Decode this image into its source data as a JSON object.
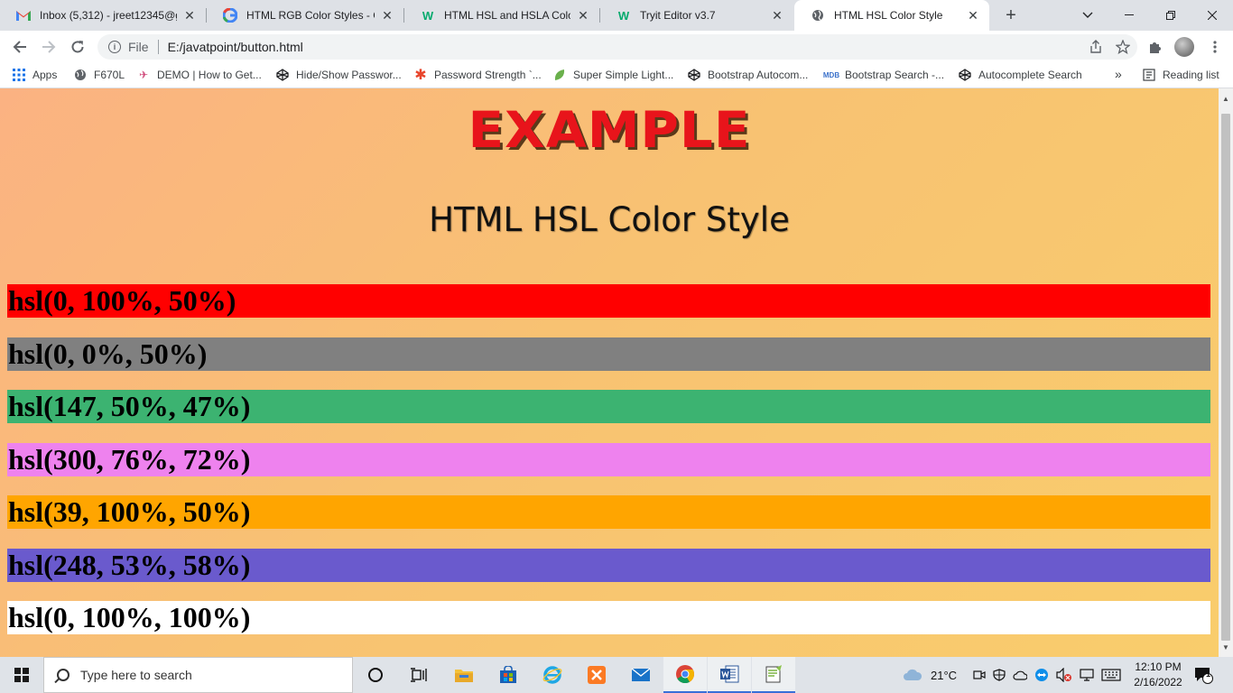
{
  "browser": {
    "tabs": [
      {
        "title": "Inbox (5,312) - jreet12345@g",
        "icon": "gmail-icon",
        "active": false
      },
      {
        "title": "HTML RGB Color Styles - Goo",
        "icon": "google-icon",
        "active": false
      },
      {
        "title": "HTML HSL and HSLA Colors",
        "icon": "w3schools-icon",
        "active": false
      },
      {
        "title": "Tryit Editor v3.7",
        "icon": "w3schools-icon",
        "active": false
      },
      {
        "title": "HTML HSL Color Style",
        "icon": "globe-icon",
        "active": true
      }
    ],
    "address": {
      "scheme": "File",
      "url": "E:/javatpoint/button.html"
    },
    "bookmarks": [
      {
        "label": "Apps",
        "icon": "apps-grid-icon"
      },
      {
        "label": "F670L",
        "icon": "globe-icon"
      },
      {
        "label": "DEMO | How to Get...",
        "icon": "bird-icon"
      },
      {
        "label": "Hide/Show Passwor...",
        "icon": "codepen-icon"
      },
      {
        "label": "Password Strength `...",
        "icon": "asterisk-icon"
      },
      {
        "label": "Super Simple Light...",
        "icon": "leaf-icon"
      },
      {
        "label": "Bootstrap Autocom...",
        "icon": "codepen-icon"
      },
      {
        "label": "Bootstrap Search -...",
        "icon": "mdb-icon"
      },
      {
        "label": "Autocomplete Search",
        "icon": "codepen-icon"
      }
    ],
    "bookmarks_overflow": "»",
    "reading_list": "Reading list"
  },
  "page": {
    "example_heading": "EXAMPLE",
    "title": "HTML HSL Color Style",
    "rows": [
      {
        "label": "hsl(0, 100%, 50%)",
        "color": "#ff0000"
      },
      {
        "label": "hsl(0, 0%, 50%)",
        "color": "#808080"
      },
      {
        "label": "hsl(147, 50%, 47%)",
        "color": "#3cb371"
      },
      {
        "label": "hsl(300, 76%, 72%)",
        "color": "#ee82ee"
      },
      {
        "label": "hsl(39, 100%, 50%)",
        "color": "#ffa500"
      },
      {
        "label": "hsl(248, 53%, 58%)",
        "color": "#6a5acd"
      },
      {
        "label": "hsl(0, 100%, 100%)",
        "color": "#ffffff"
      }
    ]
  },
  "taskbar": {
    "search_placeholder": "Type here to search",
    "weather": "21°C",
    "time": "12:10 PM",
    "date": "2/16/2022",
    "notification_count": "1"
  }
}
